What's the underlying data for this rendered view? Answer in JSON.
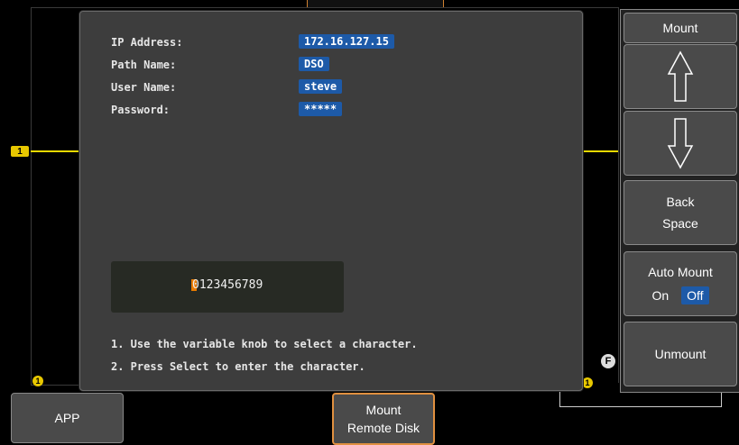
{
  "dialog": {
    "fields": [
      {
        "label": "IP Address:",
        "value": "172.16.127.15"
      },
      {
        "label": "Path Name:",
        "value": "DSO"
      },
      {
        "label": "User Name:",
        "value": "steve"
      },
      {
        "label": "Password:",
        "value": "*****"
      }
    ],
    "char_input": "0123456789",
    "instructions": [
      "1. Use the variable knob to select a character.",
      "2. Press Select to enter the character."
    ]
  },
  "side_menu": {
    "title": "Mount",
    "up_icon": "arrow-up-icon",
    "down_icon": "arrow-down-icon",
    "back_space": [
      "Back",
      "Space"
    ],
    "auto_mount": {
      "label": "Auto Mount",
      "on": "On",
      "off": "Off",
      "selected": "Off"
    },
    "unmount": "Unmount"
  },
  "bottom_menu": {
    "app": "APP",
    "mount_remote": [
      "Mount",
      "Remote Disk"
    ]
  },
  "indicators": {
    "channel": "1",
    "f_label": "F"
  },
  "colors": {
    "accent_blue": "#1d5aa8",
    "channel_yellow": "#e8c800",
    "highlight_orange": "#e09040"
  }
}
